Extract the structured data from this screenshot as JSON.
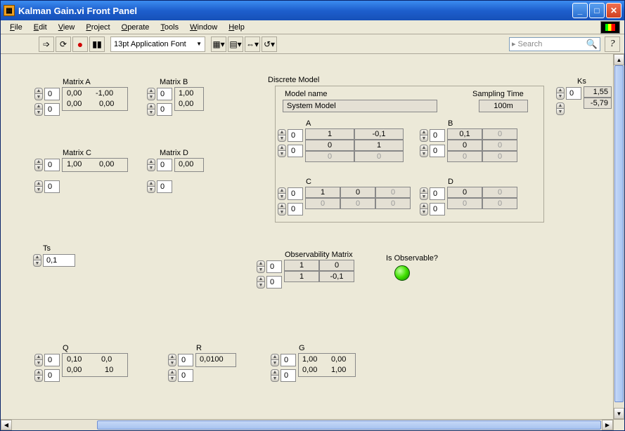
{
  "window": {
    "title": "Kalman Gain.vi Front Panel"
  },
  "menu": {
    "file": "File",
    "edit": "Edit",
    "view": "View",
    "project": "Project",
    "operate": "Operate",
    "tools": "Tools",
    "window": "Window",
    "help": "Help"
  },
  "toolbar": {
    "font": "13pt Application Font",
    "search_placeholder": "Search",
    "help": "?"
  },
  "labels": {
    "matrixA": "Matrix A",
    "matrixB": "Matrix B",
    "matrixC": "Matrix C",
    "matrixD": "Matrix D",
    "ts": "Ts",
    "q": "Q",
    "r": "R",
    "g": "G",
    "ks": "Ks",
    "discreteModel": "Discrete Model",
    "modelName": "Model name",
    "samplingTime": "Sampling Time",
    "a": "A",
    "b": "B",
    "c": "C",
    "d": "D",
    "obsMatrix": "Observability  Matrix",
    "isObs": "Is Observable?"
  },
  "matrixA": {
    "idx0": "0",
    "idx1": "0",
    "r0c0": "0,00",
    "r0c1": "-1,00",
    "r1c0": "0,00",
    "r1c1": "0,00"
  },
  "matrixB": {
    "idx0": "0",
    "idx1": "0",
    "r0": "1,00",
    "r1": "0,00"
  },
  "matrixC": {
    "idx0": "0",
    "idx1": "0",
    "r0c0": "1,00",
    "r0c1": "0,00"
  },
  "matrixD": {
    "idx0": "0",
    "idx1": "0",
    "r0": "0,00"
  },
  "ts": {
    "val": "0,1"
  },
  "q": {
    "idx0": "0",
    "idx1": "0",
    "r0c0": "0,10",
    "r0c1": "0,0",
    "r1c0": "0,00",
    "r1c1": "10"
  },
  "r": {
    "idx0": "0",
    "idx1": "0",
    "r0": "0,0100"
  },
  "g": {
    "idx0": "0",
    "idx1": "0",
    "r0c0": "1,00",
    "r0c1": "0,00",
    "r1c0": "0,00",
    "r1c1": "1,00"
  },
  "ks": {
    "idx": "0",
    "r0": "1,55",
    "r1": "-5,79"
  },
  "discrete": {
    "modelName": "System Model",
    "samplingTime": "100m",
    "a": {
      "idx0": "0",
      "idx1": "0",
      "r0c0": "1",
      "r0c1": "-0,1",
      "r1c0": "0",
      "r1c1": "1",
      "r2c0": "0",
      "r2c1": "0"
    },
    "b": {
      "idx0": "0",
      "idx1": "0",
      "r0c0": "0,1",
      "r0c1": "0",
      "r1c0": "0",
      "r1c1": "0",
      "r2c0": "0",
      "r2c1": "0"
    },
    "c": {
      "idx0": "0",
      "idx1": "0",
      "r0c0": "1",
      "r0c1": "0",
      "r0c2": "0",
      "r1c0": "0",
      "r1c1": "0",
      "r1c2": "0"
    },
    "d": {
      "idx0": "0",
      "idx1": "0",
      "r0c0": "0",
      "r0c1": "0",
      "r1c0": "0",
      "r1c1": "0"
    }
  },
  "obs": {
    "idx0": "0",
    "idx1": "0",
    "r0c0": "1",
    "r0c1": "0",
    "r1c0": "1",
    "r1c1": "-0,1"
  }
}
